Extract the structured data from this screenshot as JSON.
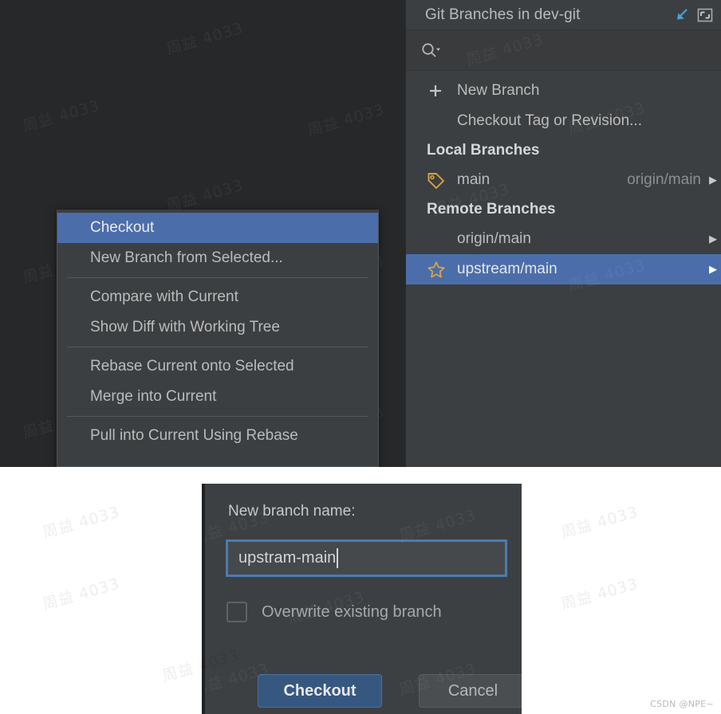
{
  "branches_popup": {
    "title": "Git Branches in dev-git",
    "header_icons": [
      {
        "name": "checkout-arrow-icon",
        "glyph": "arrow-down-left"
      },
      {
        "name": "restore-window-icon",
        "glyph": "restore"
      }
    ],
    "search": {
      "icon": "search-icon",
      "value": "",
      "placeholder": ""
    },
    "actions": [
      {
        "icon": "plus-icon",
        "label": "New Branch"
      },
      {
        "icon": "",
        "label": "Checkout Tag or Revision..."
      }
    ],
    "groups": [
      {
        "label": "Local Branches",
        "items": [
          {
            "icon": "tag-icon",
            "label": "main",
            "tracking": "origin/main",
            "arrow": "▶",
            "selected": false
          }
        ]
      },
      {
        "label": "Remote Branches",
        "items": [
          {
            "icon": "",
            "label": "origin/main",
            "tracking": "",
            "arrow": "▶",
            "selected": false
          },
          {
            "icon": "star-icon",
            "label": "upstream/main",
            "tracking": "",
            "arrow": "▶",
            "selected": true
          }
        ]
      }
    ]
  },
  "context_menu": {
    "items": [
      {
        "label": "Checkout",
        "selected": true,
        "separator_after": false
      },
      {
        "label": "New Branch from Selected...",
        "selected": false,
        "separator_after": true
      },
      {
        "label": "Compare with Current",
        "selected": false,
        "separator_after": false
      },
      {
        "label": "Show Diff with Working Tree",
        "selected": false,
        "separator_after": true
      },
      {
        "label": "Rebase Current onto Selected",
        "selected": false,
        "separator_after": false
      },
      {
        "label": "Merge into Current",
        "selected": false,
        "separator_after": true
      },
      {
        "label": "Pull into Current Using Rebase",
        "selected": false,
        "separator_after": false
      }
    ]
  },
  "dialog": {
    "label": "New branch name:",
    "input_value": "upstram-main",
    "input_placeholder": "",
    "checkbox_label": "Overwrite existing branch",
    "checkbox_checked": false,
    "primary_button": "Checkout",
    "secondary_button": "Cancel"
  },
  "watermarks": {
    "tiled_text": "周益 4033",
    "corner_text": "CSDN @NPE~"
  },
  "colors": {
    "selection_blue": "#4b6eab",
    "panel_bg": "#3c3f41",
    "editor_bg": "#26282a",
    "dialog_bg": "#3c4043",
    "icon_gold": "#d9a343",
    "accent_blue": "#4b7bb0",
    "text": "#bbbbbb"
  }
}
